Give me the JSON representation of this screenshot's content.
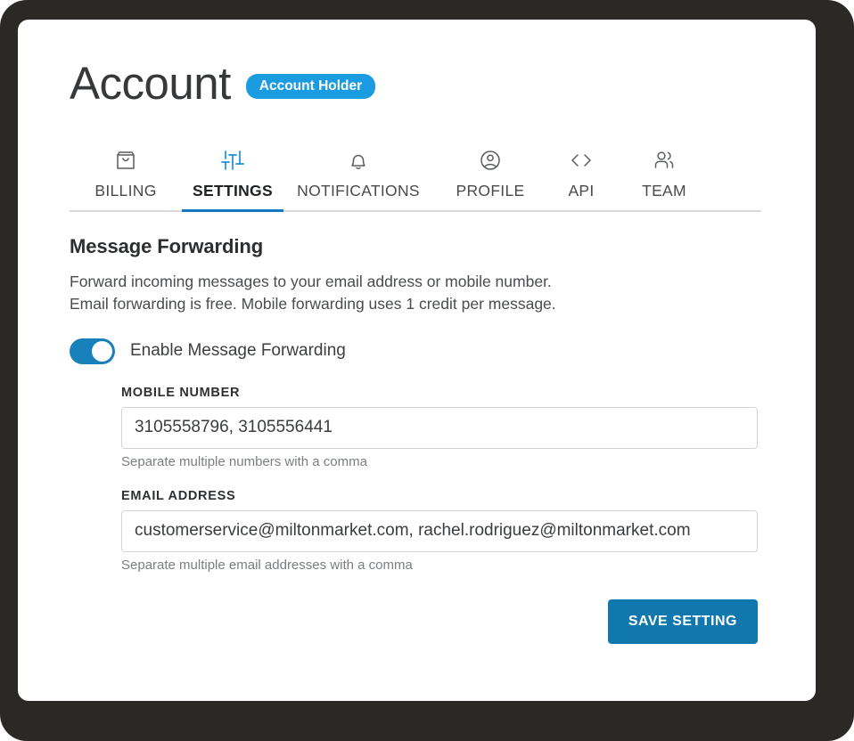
{
  "header": {
    "title": "Account",
    "badge": "Account Holder",
    "badge_color": "#1b9ce0"
  },
  "tabs": [
    {
      "label": "BILLING",
      "icon": "shopping-bag-icon",
      "active": false
    },
    {
      "label": "SETTINGS",
      "icon": "sliders-icon",
      "active": true
    },
    {
      "label": "NOTIFICATIONS",
      "icon": "bell-icon",
      "active": false
    },
    {
      "label": "PROFILE",
      "icon": "user-circle-icon",
      "active": false
    },
    {
      "label": "API",
      "icon": "code-brackets-icon",
      "active": false
    },
    {
      "label": "TEAM",
      "icon": "users-icon",
      "active": false
    }
  ],
  "section": {
    "title": "Message Forwarding",
    "description_line1": "Forward incoming messages to your email address or mobile number.",
    "description_line2": "Email forwarding is free. Mobile forwarding uses 1 credit per message."
  },
  "toggle": {
    "label": "Enable Message Forwarding",
    "state": "on",
    "color": "#1881bc"
  },
  "fields": {
    "mobile": {
      "label": "MOBILE NUMBER",
      "value": "3105558796, 3105556441",
      "placeholder": "",
      "hint": "Separate multiple numbers with a comma"
    },
    "email": {
      "label": "EMAIL ADDRESS",
      "value": "customerservice@miltonmarket.com, rachel.rodriguez@miltonmarket.com",
      "placeholder": "",
      "hint": "Separate multiple email addresses with a comma"
    }
  },
  "footer": {
    "save_label": "SAVE SETTING",
    "save_color": "#1178ae"
  },
  "accent": {
    "active_tab_underline": "#1479c0",
    "active_tab_icon": "#1a8fd8"
  }
}
